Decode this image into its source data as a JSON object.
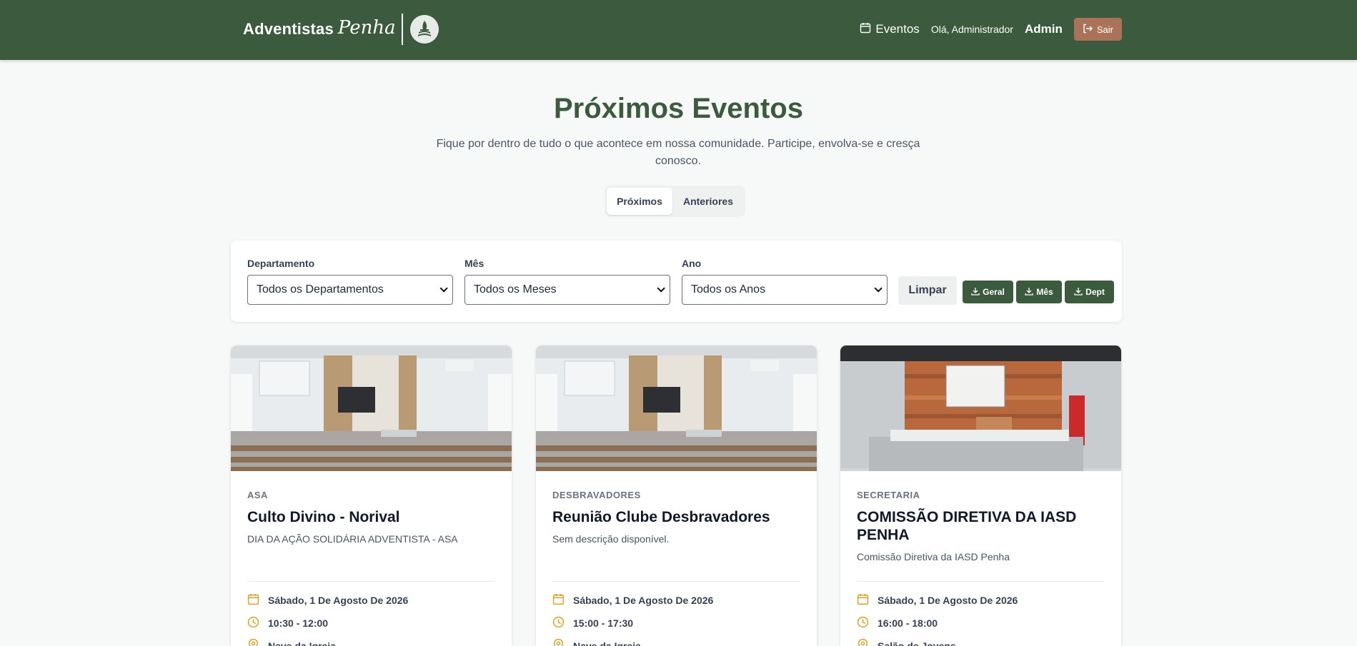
{
  "header": {
    "brand_main": "Adventistas",
    "brand_script": "Penha",
    "nav_events": "Eventos",
    "greeting": "Olá, Administrador",
    "admin_link": "Admin",
    "logout_label": "Sair"
  },
  "hero": {
    "title": "Próximos Eventos",
    "subtitle": "Fique por dentro de tudo o que acontece em nossa comunidade. Participe, envolva-se e cresça conosco."
  },
  "tabs": [
    {
      "label": "Próximos",
      "active": true
    },
    {
      "label": "Anteriores",
      "active": false
    }
  ],
  "filters": {
    "department": {
      "label": "Departamento",
      "value": "Todos os Departamentos"
    },
    "month": {
      "label": "Mês",
      "value": "Todos os Meses"
    },
    "year": {
      "label": "Ano",
      "value": "Todos os Anos"
    },
    "clear_label": "Limpar",
    "downloads": [
      "Geral",
      "Mês",
      "Dept"
    ]
  },
  "events": [
    {
      "department": "ASA",
      "title": "Culto Divino - Norival",
      "description": "DIA DA AÇÃO SOLIDÁRIA ADVENTISTA - ASA",
      "date": "Sábado, 1 De Agosto De 2026",
      "time": "10:30 - 12:00",
      "location": "Nave da Igreja",
      "image": "church-sanctuary"
    },
    {
      "department": "DESBRAVADORES",
      "title": "Reunião Clube Desbravadores",
      "description": "Sem descrição disponível.",
      "date": "Sábado, 1 De Agosto De 2026",
      "time": "15:00 - 17:30",
      "location": "Nave da Igreja",
      "image": "church-sanctuary"
    },
    {
      "department": "SECRETARIA",
      "title": "COMISSÃO DIRETIVA DA IASD PENHA",
      "description": "Comissão Diretiva da IASD Penha",
      "date": "Sábado, 1 De Agosto De 2026",
      "time": "16:00 - 18:00",
      "location": "Salão de Jovens",
      "image": "youth-hall"
    }
  ],
  "colors": {
    "header_bg": "#3b5a3e",
    "accent_green": "#3b5a3e",
    "logout_bg": "#a97259",
    "meta_icon": "#d4a22a"
  },
  "icons": {
    "calendar": "calendar-icon",
    "clock": "clock-icon",
    "location": "map-pin-icon",
    "download": "download-icon",
    "logout": "logout-icon"
  }
}
